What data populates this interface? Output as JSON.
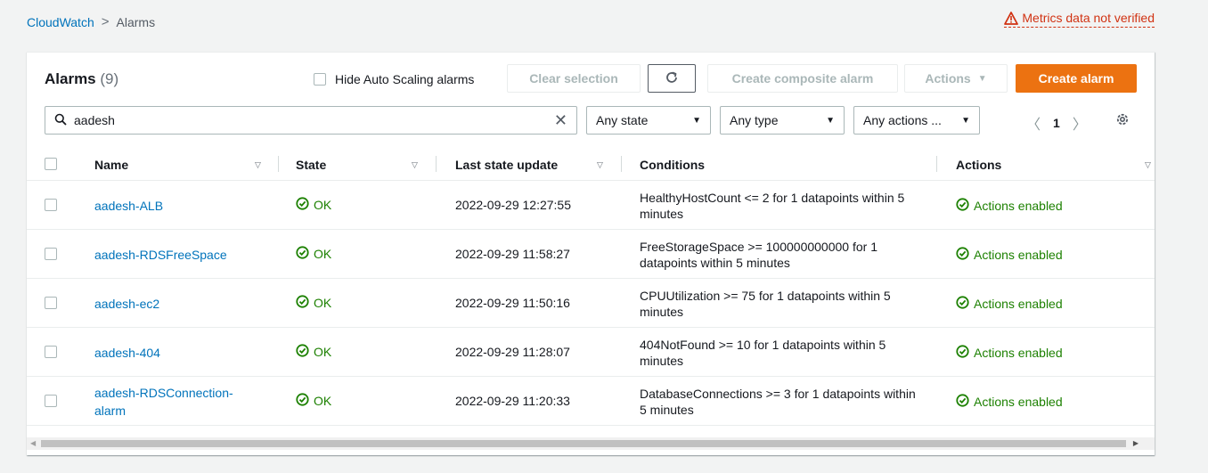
{
  "breadcrumb": {
    "items": [
      "CloudWatch",
      "Alarms"
    ],
    "separator": ">"
  },
  "warning": {
    "text": "Metrics data not verified",
    "icon": "warning-triangle-icon",
    "color": "#d13212"
  },
  "panel": {
    "title": "Alarms",
    "count": "(9)",
    "hide_auto_scaling_label": "Hide Auto Scaling alarms",
    "buttons": {
      "clear_selection": "Clear selection",
      "refresh_icon": "refresh-icon",
      "create_composite": "Create composite alarm",
      "actions": "Actions",
      "create_alarm": "Create alarm"
    }
  },
  "filters": {
    "search_value": "aadesh",
    "state": "Any state",
    "type": "Any type",
    "actions": "Any actions ..."
  },
  "pagination": {
    "current_page": "1"
  },
  "table": {
    "columns": [
      "Name",
      "State",
      "Last state update",
      "Conditions",
      "Actions"
    ],
    "rows": [
      {
        "name": "aadesh-ALB",
        "state": "OK",
        "updated": "2022-09-29 12:27:55",
        "condition": "HealthyHostCount <= 2 for 1 datapoints within 5 minutes",
        "actions": "Actions enabled"
      },
      {
        "name": "aadesh-RDSFreeSpace",
        "state": "OK",
        "updated": "2022-09-29 11:58:27",
        "condition": "FreeStorageSpace >= 100000000000 for 1 datapoints within 5 minutes",
        "actions": "Actions enabled"
      },
      {
        "name": "aadesh-ec2",
        "state": "OK",
        "updated": "2022-09-29 11:50:16",
        "condition": "CPUUtilization >= 75 for 1 datapoints within 5 minutes",
        "actions": "Actions enabled"
      },
      {
        "name": "aadesh-404",
        "state": "OK",
        "updated": "2022-09-29 11:28:07",
        "condition": "404NotFound >= 10 for 1 datapoints within 5 minutes",
        "actions": "Actions enabled"
      },
      {
        "name": "aadesh-RDSConnection-alarm",
        "state": "OK",
        "updated": "2022-09-29 11:20:33",
        "condition": "DatabaseConnections >= 3 for 1 datapoints within 5 minutes",
        "actions": "Actions enabled"
      }
    ]
  },
  "colors": {
    "link": "#0073bb",
    "ok": "#1d8102",
    "primary": "#ec7211"
  }
}
